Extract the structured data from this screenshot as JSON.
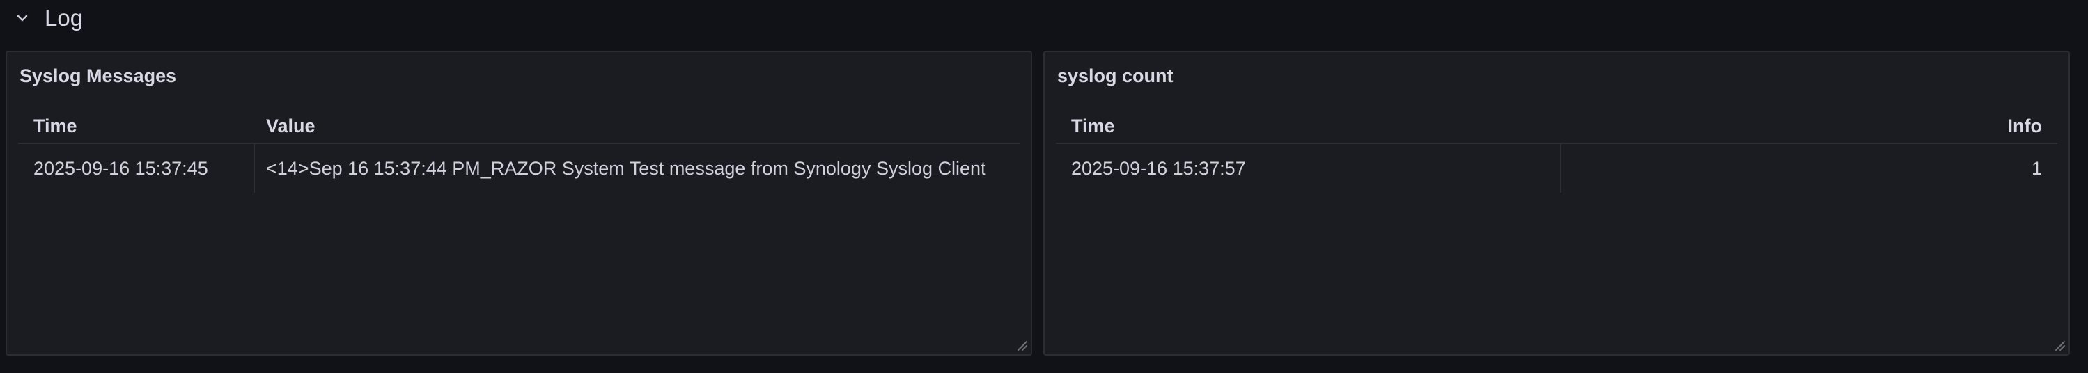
{
  "row": {
    "title": "Log",
    "chevron_icon": "chevron-down-icon"
  },
  "panels": [
    {
      "title": "Syslog Messages",
      "columns": [
        "Time",
        "Value"
      ],
      "rows": [
        {
          "time": "2025-09-16 15:37:45",
          "value": "<14>Sep 16 15:37:44 PM_RAZOR System Test message from Synology Syslog Client"
        }
      ]
    },
    {
      "title": "syslog count",
      "columns": [
        "Time",
        "Info"
      ],
      "rows": [
        {
          "time": "2025-09-16 15:37:57",
          "info": "1"
        }
      ]
    }
  ],
  "colors": {
    "background": "#111217",
    "panel_background": "#1b1c21",
    "panel_border": "#2b2d33",
    "text": "#d0d1dc"
  }
}
